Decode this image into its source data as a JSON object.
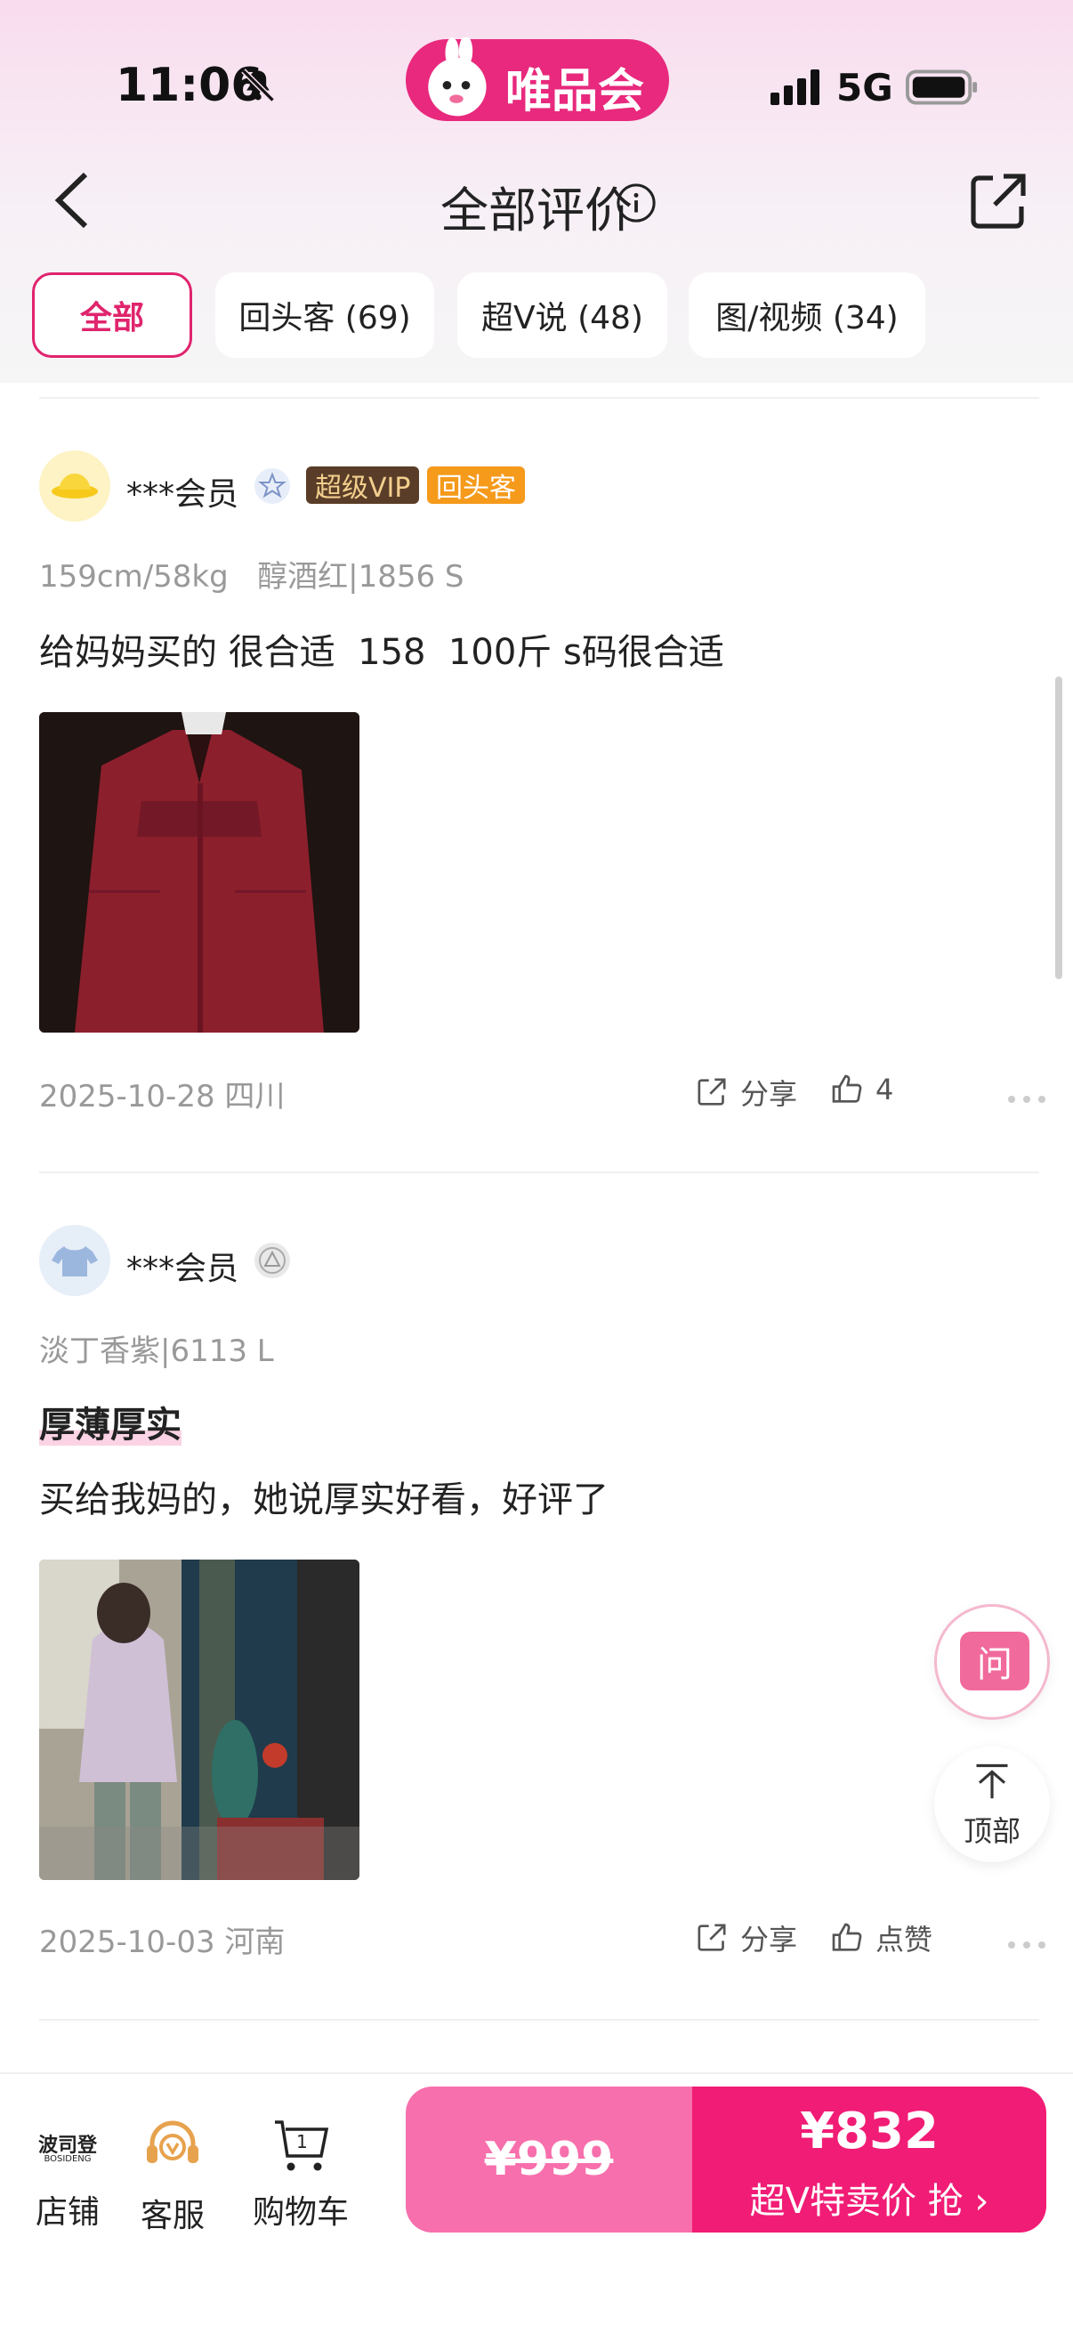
{
  "status_bar": {
    "time": "11:06",
    "network": "5G"
  },
  "brand": {
    "name": "唯品会",
    "color": "#e8297d"
  },
  "header": {
    "title": "全部评价"
  },
  "tabs": [
    {
      "label": "全部",
      "active": true
    },
    {
      "label": "回头客 (69)",
      "active": false
    },
    {
      "label": "超V说 (48)",
      "active": false
    },
    {
      "label": "图/视频 (34)",
      "active": false
    }
  ],
  "reviews": [
    {
      "username": "***会员",
      "tags": [
        "超级VIP",
        "回头客"
      ],
      "meta": "159cm/58kg   醇酒红|1856 S",
      "content": "给妈妈买的 很合适  158  100斤 s码很合适",
      "date_location": "2025-10-28 四川",
      "share_label": "分享",
      "likes": "4"
    },
    {
      "username": "***会员",
      "meta": "淡丁香紫|6113 L",
      "headline": "厚薄厚实",
      "content": "买给我妈的，她说厚实好看，好评了",
      "date_location": "2025-10-03 河南",
      "share_label": "分享",
      "like_label": "点赞"
    }
  ],
  "floating": {
    "ask_label": "问",
    "top_label": "顶部"
  },
  "bottom_bar": {
    "shop_logo": "波司登",
    "shop_logo_en": "BOSIDENG",
    "shop_label": "店铺",
    "service_label": "客服",
    "cart_label": "购物车",
    "cart_count": "1",
    "original_price": "¥999",
    "sale_price": "¥832",
    "cta": "超V特卖价 抢 ›"
  }
}
